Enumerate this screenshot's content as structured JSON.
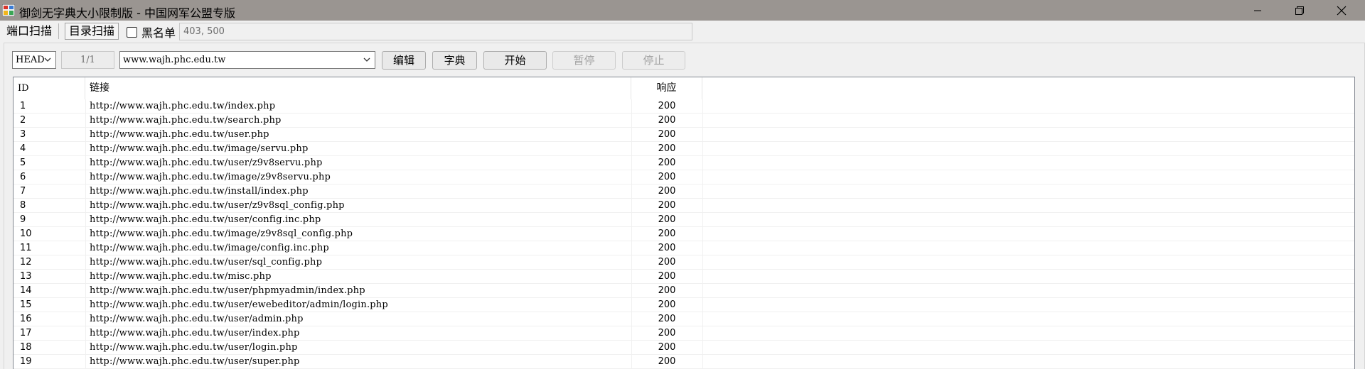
{
  "window": {
    "title": "御剑无字典大小限制版 - 中国网军公盟专版",
    "icon": "app-grid-icon",
    "controls": [
      "minimize-icon",
      "restore-icon",
      "close-icon"
    ]
  },
  "tabs": [
    {
      "label": "端口扫描",
      "active": false
    },
    {
      "label": "目录扫描",
      "active": true
    }
  ],
  "blacklist": {
    "label": "黑名单",
    "checked": false,
    "codes": "403, 500"
  },
  "toolbar": {
    "method": "HEAD",
    "progress": "1/1",
    "target": "www.wajh.phc.edu.tw",
    "edit_label": "编辑",
    "dict_label": "字典",
    "start_label": "开始",
    "pause_label": "暂停",
    "stop_label": "停止"
  },
  "grid": {
    "headers": {
      "id": "ID",
      "url": "链接",
      "code": "响应"
    },
    "rows": [
      {
        "id": "1",
        "url": "http://www.wajh.phc.edu.tw/index.php",
        "code": "200"
      },
      {
        "id": "2",
        "url": "http://www.wajh.phc.edu.tw/search.php",
        "code": "200"
      },
      {
        "id": "3",
        "url": "http://www.wajh.phc.edu.tw/user.php",
        "code": "200"
      },
      {
        "id": "4",
        "url": "http://www.wajh.phc.edu.tw/image/servu.php",
        "code": "200"
      },
      {
        "id": "5",
        "url": "http://www.wajh.phc.edu.tw/user/z9v8servu.php",
        "code": "200"
      },
      {
        "id": "6",
        "url": "http://www.wajh.phc.edu.tw/image/z9v8servu.php",
        "code": "200"
      },
      {
        "id": "7",
        "url": "http://www.wajh.phc.edu.tw/install/index.php",
        "code": "200"
      },
      {
        "id": "8",
        "url": "http://www.wajh.phc.edu.tw/user/z9v8sql_config.php",
        "code": "200"
      },
      {
        "id": "9",
        "url": "http://www.wajh.phc.edu.tw/user/config.inc.php",
        "code": "200"
      },
      {
        "id": "10",
        "url": "http://www.wajh.phc.edu.tw/image/z9v8sql_config.php",
        "code": "200"
      },
      {
        "id": "11",
        "url": "http://www.wajh.phc.edu.tw/image/config.inc.php",
        "code": "200"
      },
      {
        "id": "12",
        "url": "http://www.wajh.phc.edu.tw/user/sql_config.php",
        "code": "200"
      },
      {
        "id": "13",
        "url": "http://www.wajh.phc.edu.tw/misc.php",
        "code": "200"
      },
      {
        "id": "14",
        "url": "http://www.wajh.phc.edu.tw/user/phpmyadmin/index.php",
        "code": "200"
      },
      {
        "id": "15",
        "url": "http://www.wajh.phc.edu.tw/user/ewebeditor/admin/login.php",
        "code": "200"
      },
      {
        "id": "16",
        "url": "http://www.wajh.phc.edu.tw/user/admin.php",
        "code": "200"
      },
      {
        "id": "17",
        "url": "http://www.wajh.phc.edu.tw/user/index.php",
        "code": "200"
      },
      {
        "id": "18",
        "url": "http://www.wajh.phc.edu.tw/user/login.php",
        "code": "200"
      },
      {
        "id": "19",
        "url": "http://www.wajh.phc.edu.tw/user/super.php",
        "code": "200"
      }
    ]
  }
}
